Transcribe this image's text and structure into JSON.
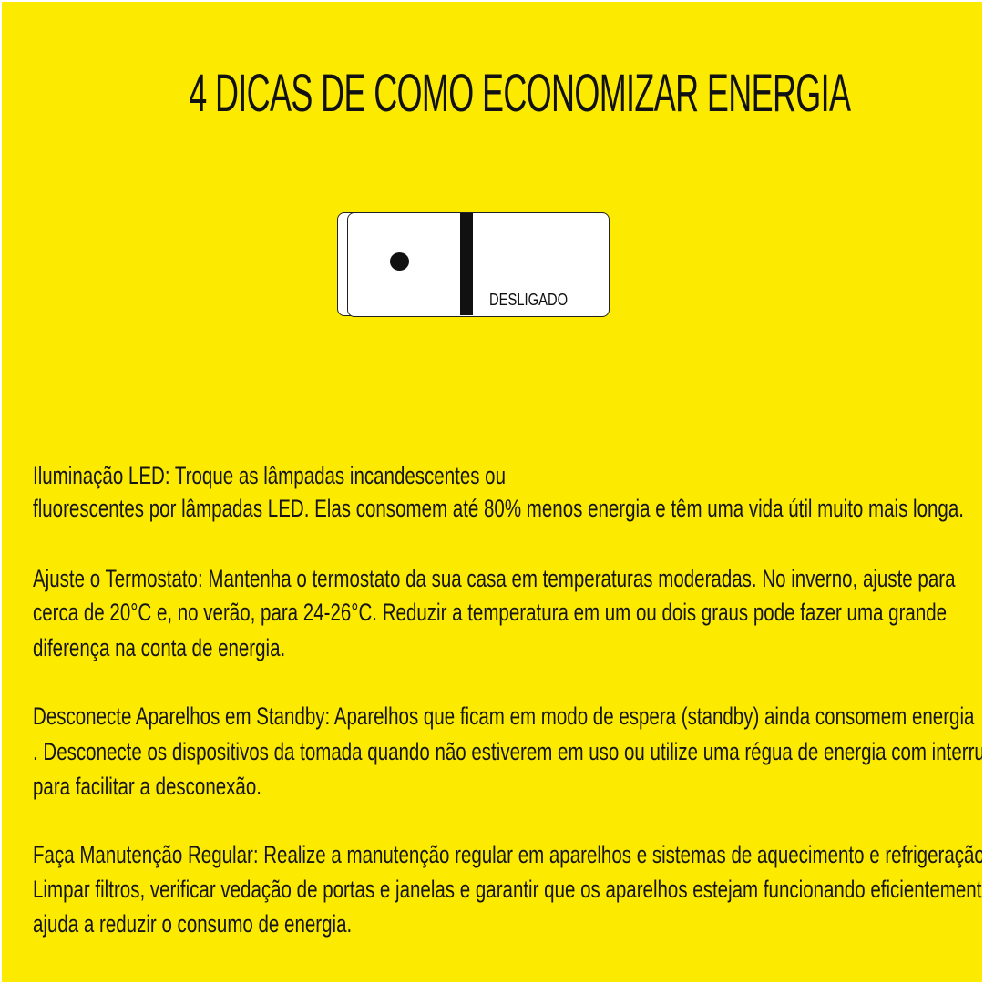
{
  "title": "4 DICAS DE COMO ECONOMIZAR ENERGIA",
  "switch": {
    "icon": "light-switch-icon",
    "state_label": "DESLIGADO"
  },
  "tips": [
    {
      "lines": [
        " Iluminação LED: Troque as lâmpadas incandescentes ou",
        "fluorescentes por lâmpadas LED. Elas consomem até 80% menos energia e têm uma vida útil muito mais longa."
      ]
    },
    {
      "lines": [
        "Ajuste o Termostato: Mantenha o termostato da sua casa em temperaturas moderadas. No inverno, ajuste para",
        "cerca de 20°C e, no verão, para 24-26°C. Reduzir a temperatura em um ou dois graus pode fazer uma grande",
        "diferença na conta de energia."
      ]
    },
    {
      "lines": [
        "Desconecte Aparelhos em Standby: Aparelhos que ficam em modo de espera (standby) ainda consomem energia",
        ". Desconecte os dispositivos da tomada quando não estiverem em uso ou utilize uma régua de energia com interruptor",
        " para facilitar a desconexão."
      ]
    },
    {
      "lines": [
        "Faça Manutenção Regular: Realize a manutenção regular em aparelhos e sistemas de aquecimento e refrigeração.",
        "Limpar filtros, verificar vedação de portas e janelas e garantir que os aparelhos estejam funcionando eficientemente",
        " ajuda a reduzir o consumo de energia."
      ]
    }
  ],
  "colors": {
    "background": "#fcea00",
    "text": "#111111",
    "switch_face": "#ffffff"
  }
}
